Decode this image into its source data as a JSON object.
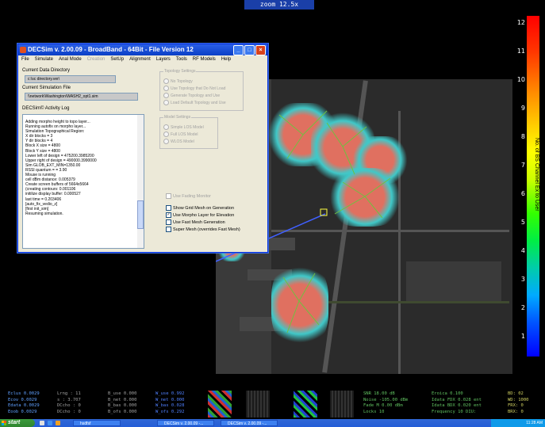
{
  "zoom_label": "zoom 12.5x",
  "scale": {
    "title": "No. of BS Channel Ex to User",
    "ticks": [
      "12",
      "11",
      "10",
      "9",
      "8",
      "7",
      "6",
      "5",
      "4",
      "3",
      "2",
      "1"
    ]
  },
  "window": {
    "title": "DECSim v. 2.00.09 - BroadBand - 64Bit - File Version 12",
    "menu": [
      {
        "label": "File",
        "disabled": false
      },
      {
        "label": "Simulate",
        "disabled": false
      },
      {
        "label": "Anal Mode",
        "disabled": false
      },
      {
        "label": "Creation",
        "disabled": true
      },
      {
        "label": "SetUp",
        "disabled": false
      },
      {
        "label": "Alignment",
        "disabled": false
      },
      {
        "label": "Layers",
        "disabled": false
      },
      {
        "label": "Tools",
        "disabled": false
      },
      {
        "label": "RF Models",
        "disabled": false
      },
      {
        "label": "Help",
        "disabled": false
      }
    ],
    "current_dir_label": "Current Data Directory",
    "current_dir_value": "c:\\sc directory.ver\\",
    "current_file_label": "Current Simulation File",
    "current_file_value": "\\\\network\\Washington\\WASH2_opt1.sim",
    "log_label": "DECSim© Activity Log",
    "log_lines": [
      "Adding morpho height to topo layer...",
      "Running autofix on morpho layer...",
      "Simulation Topographical Region:",
      "  X dir blocks = 3",
      "  Y dir blocks = 4",
      "  Block X size = 4800",
      "  Block Y size = 4800",
      "  Lower left  of design = 475200.3985200",
      "  Upper right of design = 490000.3990000",
      "Sim GLOB_EXT_MIN=1350.00",
      "RSSI quantum = = 3.90",
      "Mouse is running",
      "cell dBm distance:   0.005379",
      "Create screen buffers of 5664x5664",
      "(creating contours:    0.001106",
      "initilize display buffer:    0.000527",
      "last time   = 0.203406",
      "[auto_fix_vedio_z]",
      "[first init_sim]",
      "Resuming simulation."
    ],
    "topology": {
      "legend": "Topology Settings",
      "options": [
        "No Topology",
        "Use Topology that Do Not Load",
        "Generate Topology and Use",
        "Load Default Topology and Use"
      ]
    },
    "model": {
      "legend": "Model Settings",
      "options": [
        "Simple LOS Model",
        "Full LOS Model",
        "WLOS Model"
      ]
    },
    "checkboxes": [
      {
        "label": "Use Fading Monitor",
        "checked": false,
        "disabled": true
      },
      {
        "label": "Show Grid Mesh on Generation",
        "checked": false,
        "disabled": false
      },
      {
        "label": "Use Morpho Layer for Elevation",
        "checked": true,
        "disabled": false
      },
      {
        "label": "Use Fast Mesh Generation",
        "checked": false,
        "disabled": false
      },
      {
        "label": "Super Mesh (overrides Fast Mesh)",
        "checked": false,
        "disabled": false
      }
    ]
  },
  "status": {
    "col1": [
      "Eclus 0.0029",
      "Ecov  0.0029",
      "Edata 0.0029",
      "Eoob  0.0029"
    ],
    "col2": [
      "Lrng :      11",
      "s    :   3.707",
      "DCcho :      0",
      "DCcho :      0"
    ],
    "col3": [
      "B_use  0.000",
      "B_net  0.000",
      "B_bas  0.000",
      "B_ofs  0.000"
    ],
    "col4": [
      "W_use  0.992",
      "W_net  0.000",
      "W_bas  0.028",
      "W_ofs  0.292"
    ],
    "col5": [
      "SNR      18.00 dB",
      "Noise  -105.00 dBm",
      "Fade M   0.00 dBm",
      "Locks        10"
    ],
    "col6": [
      "Eroica    0.100",
      "Idata FDX  0.028 ent",
      "Idata BDX  0.020 ent",
      "Frequency  10  DIU:"
    ],
    "col7": [
      "BD:    02",
      "WD:  1000",
      "FRX:     0",
      "BRX:     0"
    ]
  },
  "taskbar": {
    "start": "start",
    "items": [
      "hsdfsf",
      "DECSim v. 2.00.09 -...",
      "DECSim v. 2.00.09 -..."
    ],
    "clock": "11:28 AM"
  },
  "colors": {
    "window_title": "#0a3fc6",
    "coverage_red": "#e07060",
    "coverage_cyan": "#40e0e0",
    "taskbar": "#245dd7"
  }
}
